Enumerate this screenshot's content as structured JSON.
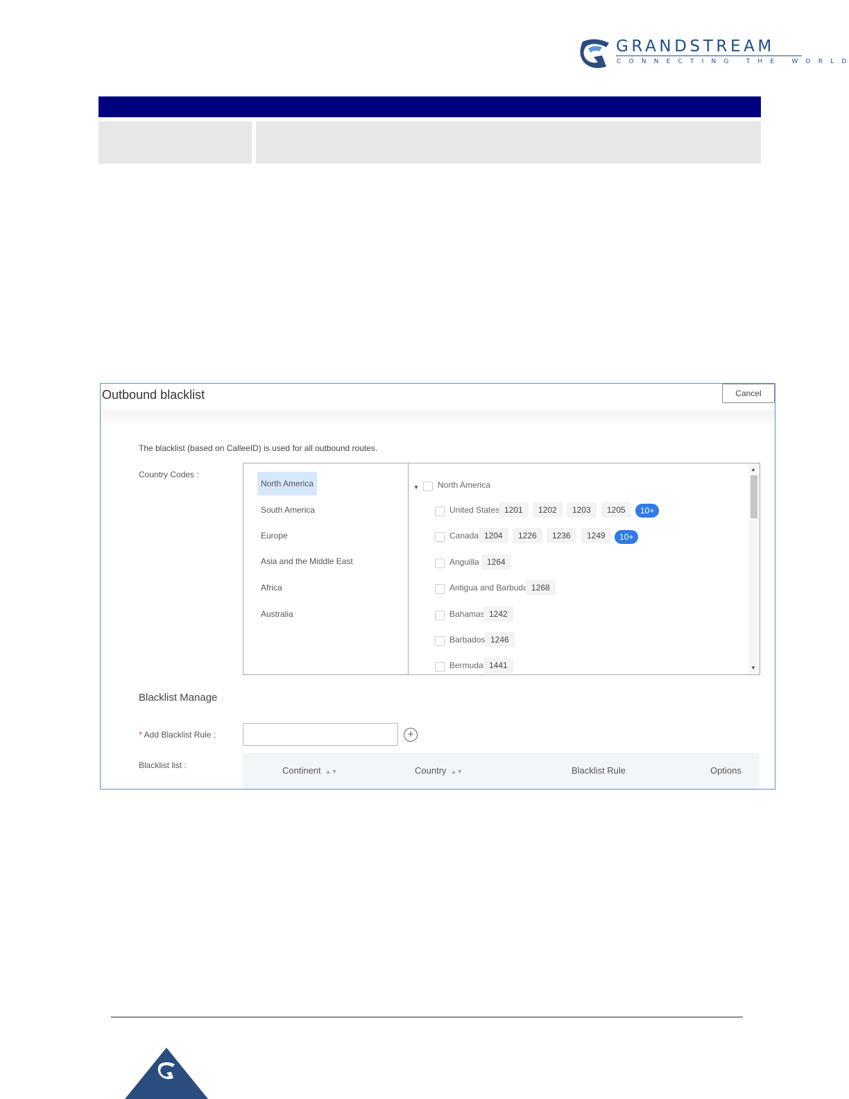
{
  "brand": {
    "wordmark": "GRANDSTREAM",
    "tagline": "CONNECTING THE WORLD",
    "logo_icon": "grandstream-logo-icon",
    "color": "#1f4d8c"
  },
  "doc_table": {
    "band_color": "#00007f",
    "cell_color": "#e7e7e7"
  },
  "dialog": {
    "title": "Outbound blacklist",
    "cancel_label": "Cancel",
    "description": "The blacklist (based on CalleeID) is used for all outbound routes.",
    "country_codes_label": "Country Codes :",
    "continents": [
      {
        "label": "North America",
        "selected": true
      },
      {
        "label": "South America"
      },
      {
        "label": "Europe"
      },
      {
        "label": "Asia and the Middle East"
      },
      {
        "label": "Africa"
      },
      {
        "label": "Australia"
      }
    ],
    "tree": {
      "group": "North America",
      "countries": [
        {
          "name": "United States",
          "codes": [
            "1201",
            "1202",
            "1203",
            "1205"
          ],
          "more": "10+"
        },
        {
          "name": "Canada",
          "codes": [
            "1204",
            "1226",
            "1236",
            "1249"
          ],
          "more": "10+"
        },
        {
          "name": "Anguilla",
          "codes": [
            "1264"
          ]
        },
        {
          "name": "Antigua and Barbuda",
          "codes": [
            "1268"
          ]
        },
        {
          "name": "Bahamas",
          "codes": [
            "1242"
          ]
        },
        {
          "name": "Barbados",
          "codes": [
            "1246"
          ]
        },
        {
          "name": "Bermuda",
          "codes": [
            "1441"
          ]
        }
      ]
    },
    "blacklist_manage": {
      "title": "Blacklist Manage",
      "add_rule_label": "Add Blacklist Rule :",
      "required_mark": "*",
      "list_label": "Blacklist list :",
      "columns": [
        "Continent",
        "Country",
        "Blacklist Rule",
        "Options"
      ],
      "sort_icon": "sort-icon"
    }
  },
  "colors": {
    "accent": "#2f7ae5",
    "selected_bg": "#d6e8fb",
    "footer_triangle": "#2b4c7e"
  }
}
